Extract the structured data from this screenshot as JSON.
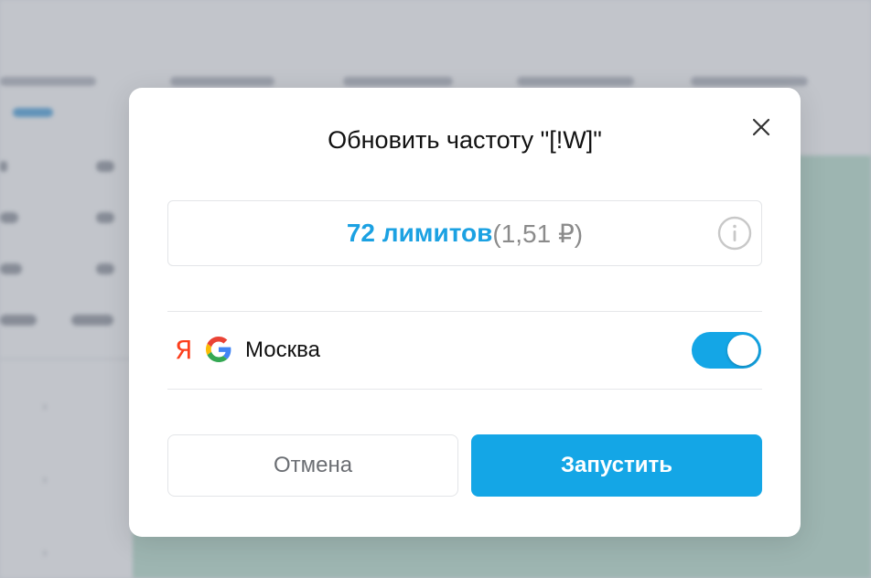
{
  "modal": {
    "title": "Обновить частоту \"[!W]\"",
    "limits": {
      "main": "72 лимитов",
      "price": "(1,51 ₽)"
    },
    "region": {
      "yandex_letter": "Я",
      "name": "Москва",
      "enabled": true
    },
    "buttons": {
      "cancel": "Отмена",
      "run": "Запустить"
    },
    "icons": {
      "close": "close-icon",
      "info": "info-icon",
      "yandex": "yandex-icon",
      "google": "google-icon"
    },
    "colors": {
      "accent": "#14a6e6",
      "limits_text": "#1ba1e2",
      "yandex_red": "#fc3f1d"
    }
  }
}
